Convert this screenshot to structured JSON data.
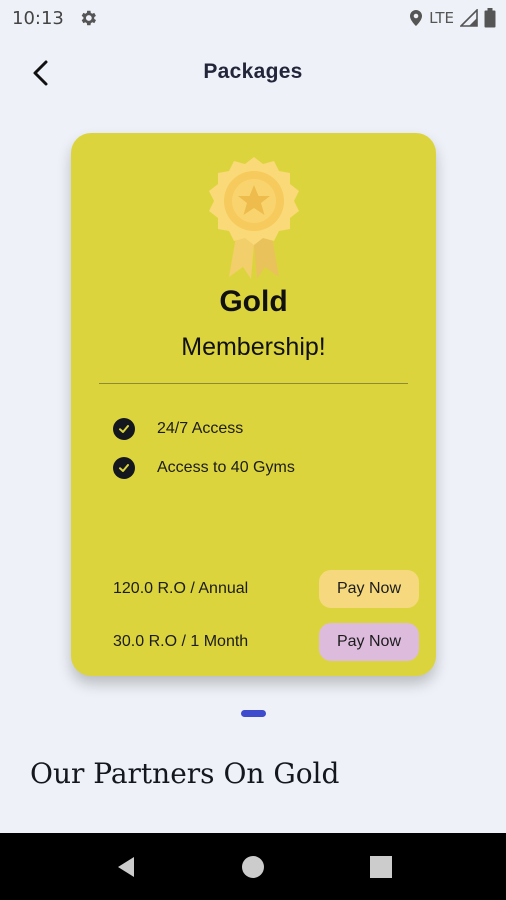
{
  "status": {
    "time": "10:13",
    "network": "LTE"
  },
  "appbar": {
    "title": "Packages"
  },
  "card": {
    "tier": "Gold",
    "subtitle": "Membership!",
    "features": [
      "24/7 Access",
      "Access to 40 Gyms"
    ],
    "plans": [
      {
        "label": "120.0 R.O / Annual",
        "button": "Pay Now",
        "color": "#f6d97e"
      },
      {
        "label": "30.0 R.O / 1 Month",
        "button": "Pay Now",
        "color": "#dcbbdd"
      }
    ],
    "color": "#dcd43d"
  },
  "pager": {
    "active_color": "#3d4bcc"
  },
  "partners": {
    "heading": "Our Partners On Gold"
  },
  "icons": [
    "gear-icon",
    "location-icon",
    "signal-icon",
    "battery-icon",
    "back-arrow-icon",
    "gold-badge-icon",
    "check-icon",
    "nav-back-icon",
    "nav-home-icon",
    "nav-recents-icon"
  ]
}
